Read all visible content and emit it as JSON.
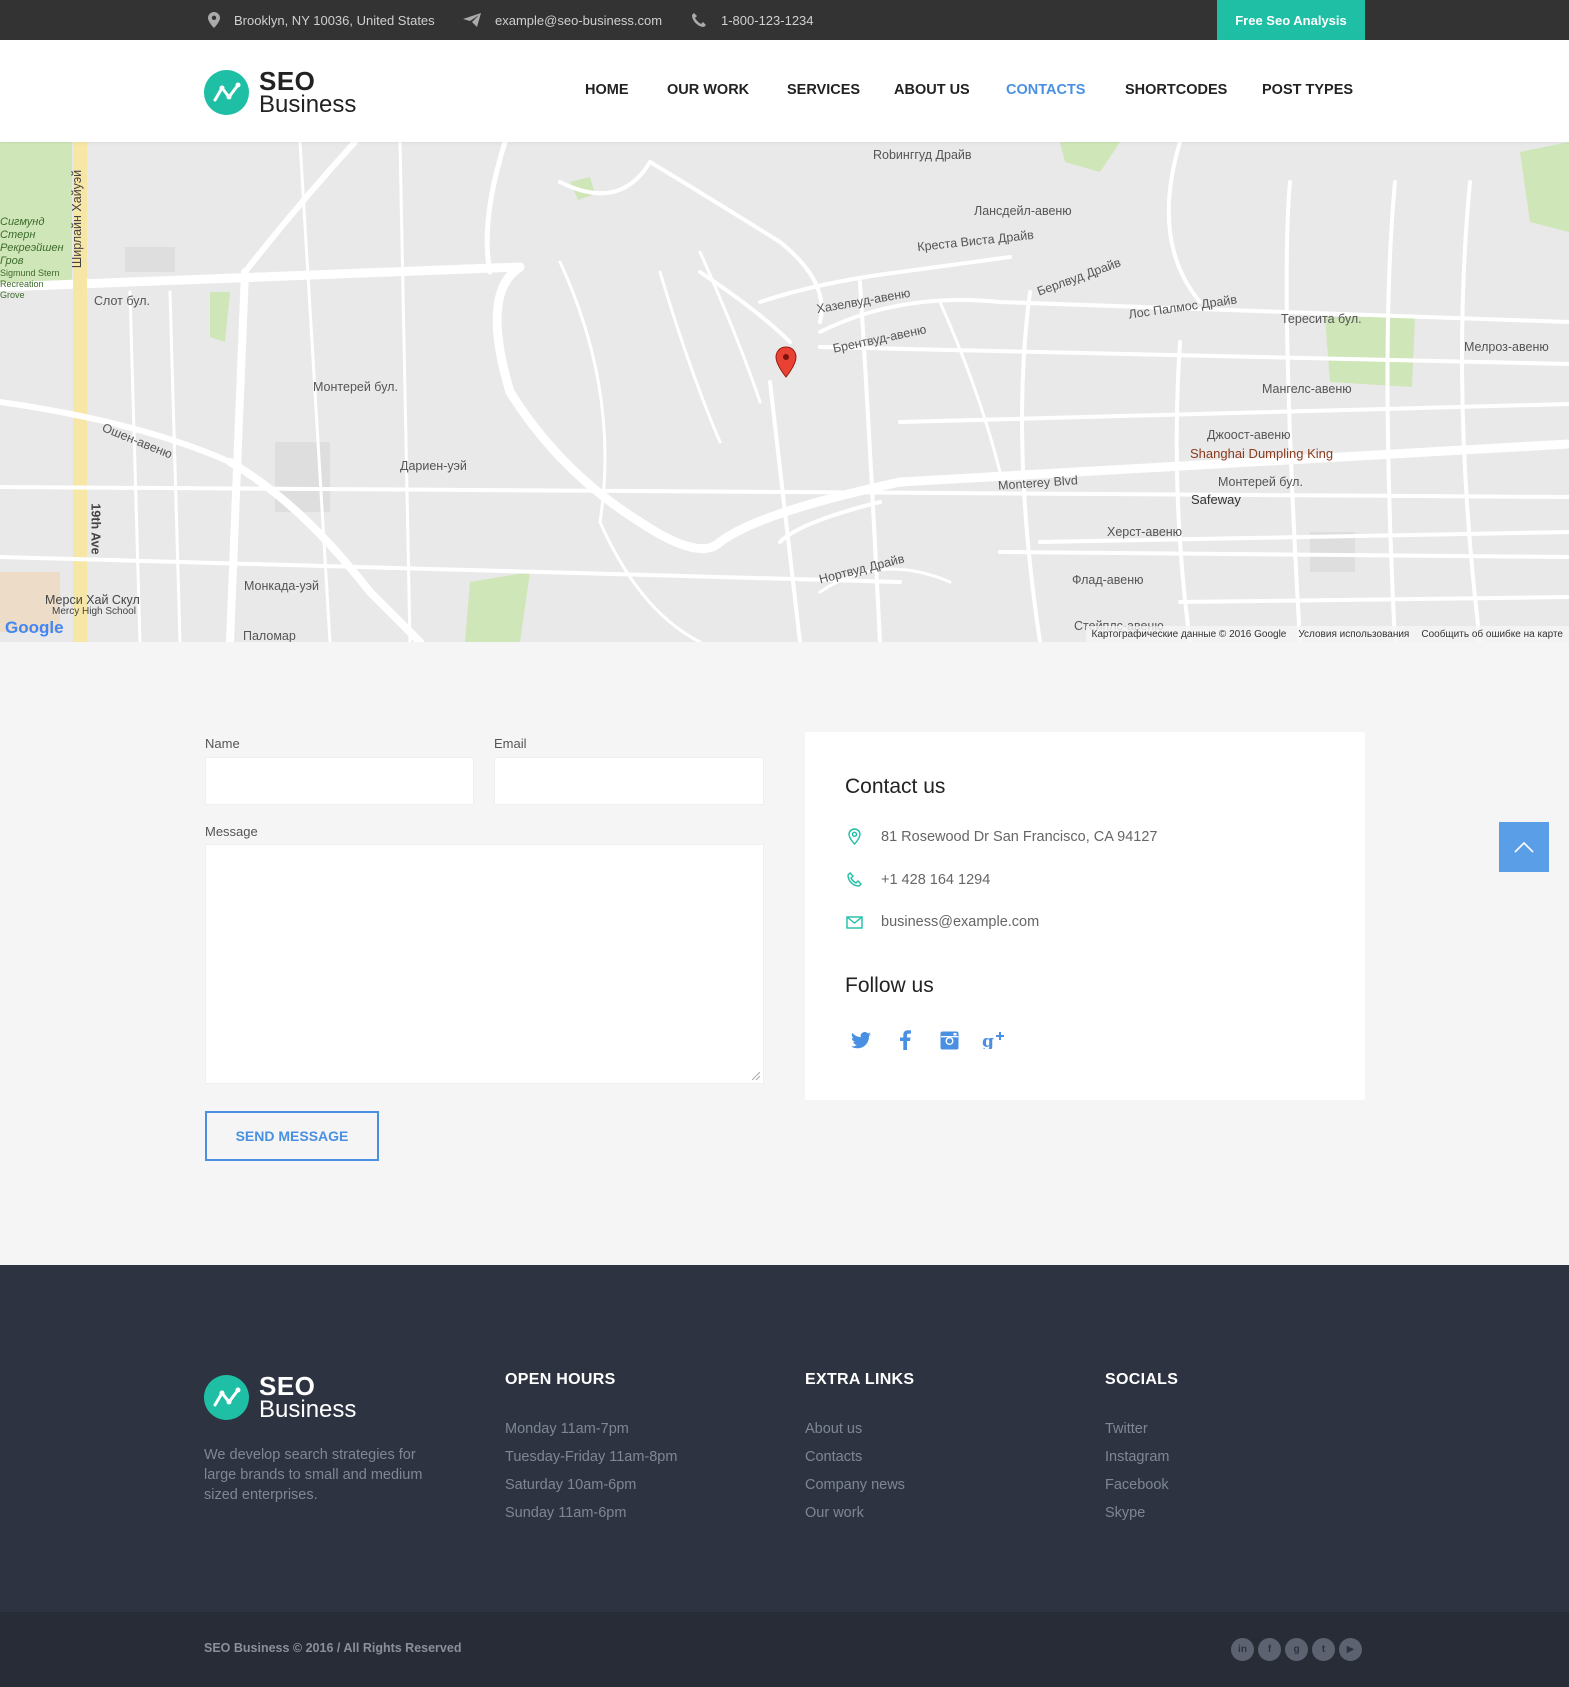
{
  "topbar": {
    "address": "Brooklyn, NY 10036, United States",
    "email": "example@seo-business.com",
    "phone": "1-800-123-1234",
    "cta_label": "Free Seo Analysis",
    "cta_color": "#1fbfa6"
  },
  "header": {
    "logo_line1": "SEO",
    "logo_line2": "Business",
    "nav": [
      "HOME",
      "OUR WORK",
      "SERVICES",
      "ABOUT US",
      "CONTACTS",
      "SHORTCODES",
      "POST TYPES"
    ],
    "active_nav": "CONTACTS",
    "accent_color": "#4a90e2"
  },
  "map": {
    "labels": [
      "Слот бул.",
      "Монтерей бул.",
      "Дариен-уэй",
      "Ошен-авеню",
      "Монкада-уэй",
      "Паломар",
      "Мерси Хай Скул",
      "Mercy High School",
      "Robинггуд Драйв",
      "Лансдейл-авеню",
      "Креста Виста Драйв",
      "Берлвуд Драйв",
      "Лос Палмос Драйв",
      "Тересита бул.",
      "Мелроз-авеню",
      "Мангелс-авеню",
      "Джоост-авеню",
      "Shanghai Dumpling King",
      "Safeway",
      "Monterey Blvd",
      "Монтерей бул.",
      "Херст-авеню",
      "Флад-авеню",
      "Стейплс-авеню",
      "Хазелвуд-авеню",
      "Брентвуд-авеню",
      "Нортвуд Драйв",
      "19th Ave",
      "Ширлайн Хайуэй",
      "Сигмунд Стерн Рекреэйшен Гров",
      "Sigmund Stern Recreation Grove",
      "Robинггуд Драйв"
    ],
    "attribution": [
      "Картографические данные © 2016 Google",
      "Условия использования",
      "Сообщить об ошибке на карте"
    ],
    "brand": "Google"
  },
  "form": {
    "name_label": "Name",
    "email_label": "Email",
    "message_label": "Message",
    "send_label": "SEND MESSAGE"
  },
  "contact": {
    "title": "Contact us",
    "address": "81 Rosewood Dr San Francisco, CA 94127",
    "phone": "+1 428 164 1294",
    "email": "business@example.com",
    "follow_title": "Follow us",
    "socials": [
      "twitter-icon",
      "facebook-icon",
      "instagram-icon",
      "google-plus-icon"
    ]
  },
  "footer": {
    "logo_line1": "SEO",
    "logo_line2": "Business",
    "description": "We develop search strategies for large brands to small and medium sized enterprises.",
    "hours_title": "OPEN HOURS",
    "hours": [
      "Monday 11am-7pm",
      "Tuesday-Friday 11am-8pm",
      "Saturday 10am-6pm",
      "Sunday 11am-6pm"
    ],
    "links_title": "EXTRA LINKS",
    "links": [
      "About us",
      "Contacts",
      "Company news",
      "Our work"
    ],
    "socials_title": "SOCIALS",
    "socials": [
      "Twitter",
      "Instagram",
      "Facebook",
      "Skype"
    ],
    "copyright": "SEO Business © 2016 / All Rights Reserved",
    "bottom_icons": [
      "linkedin-icon",
      "facebook-icon",
      "google-plus-icon",
      "twitter-icon",
      "youtube-icon"
    ]
  }
}
